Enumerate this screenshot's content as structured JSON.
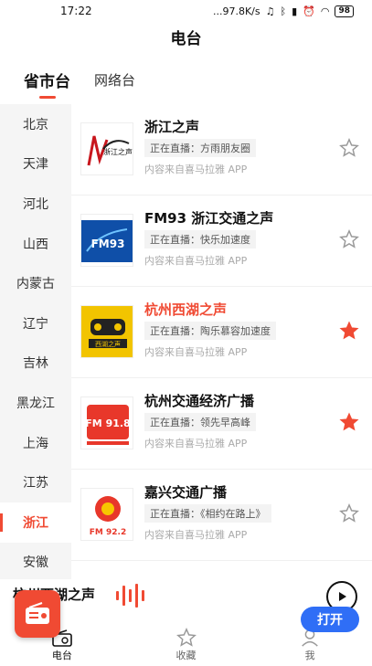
{
  "status_bar": {
    "time": "17:22",
    "network_speed": "...97.8K/s",
    "battery": "98"
  },
  "header": {
    "title": "电台"
  },
  "tabs": [
    {
      "label": "省市台",
      "active": true
    },
    {
      "label": "网络台",
      "active": false
    }
  ],
  "provinces": [
    "北京",
    "天津",
    "河北",
    "山西",
    "内蒙古",
    "辽宁",
    "吉林",
    "黑龙江",
    "上海",
    "江苏",
    "浙江",
    "安徽"
  ],
  "selected_province": "浙江",
  "stations": [
    {
      "name": "浙江之声",
      "live": "正在直播：方雨朋友圈",
      "source": "内容来自喜马拉雅 APP",
      "favorited": false,
      "playing": false,
      "logo_text": "浙江之声"
    },
    {
      "name": "FM93 浙江交通之声",
      "live": "正在直播：快乐加速度",
      "source": "内容来自喜马拉雅 APP",
      "favorited": false,
      "playing": false,
      "logo_text": "FM93"
    },
    {
      "name": "杭州西湖之声",
      "live": "正在直播：陶乐慕容加速度",
      "source": "内容来自喜马拉雅 APP",
      "favorited": true,
      "playing": true,
      "logo_text": "西湖之声"
    },
    {
      "name": "杭州交通经济广播",
      "live": "正在直播：领先早高峰",
      "source": "内容来自喜马拉雅 APP",
      "favorited": true,
      "playing": false,
      "logo_text": "FM 91.8"
    },
    {
      "name": "嘉兴交通广播",
      "live": "正在直播：《相约在路上》",
      "source": "内容来自喜马拉雅 APP",
      "favorited": false,
      "playing": false,
      "logo_text": "FM 92.2"
    }
  ],
  "player": {
    "now_playing": "杭州西湖之声"
  },
  "bottom_nav": [
    {
      "label": "电台",
      "icon": "radio-icon",
      "active": true
    },
    {
      "label": "收藏",
      "icon": "star-icon",
      "active": false
    },
    {
      "label": "我",
      "icon": "user-icon",
      "active": false
    }
  ],
  "open_button": "打开",
  "colors": {
    "accent": "#f04a33",
    "open_button": "#2f6ef6",
    "favorite": "#f04a33"
  }
}
